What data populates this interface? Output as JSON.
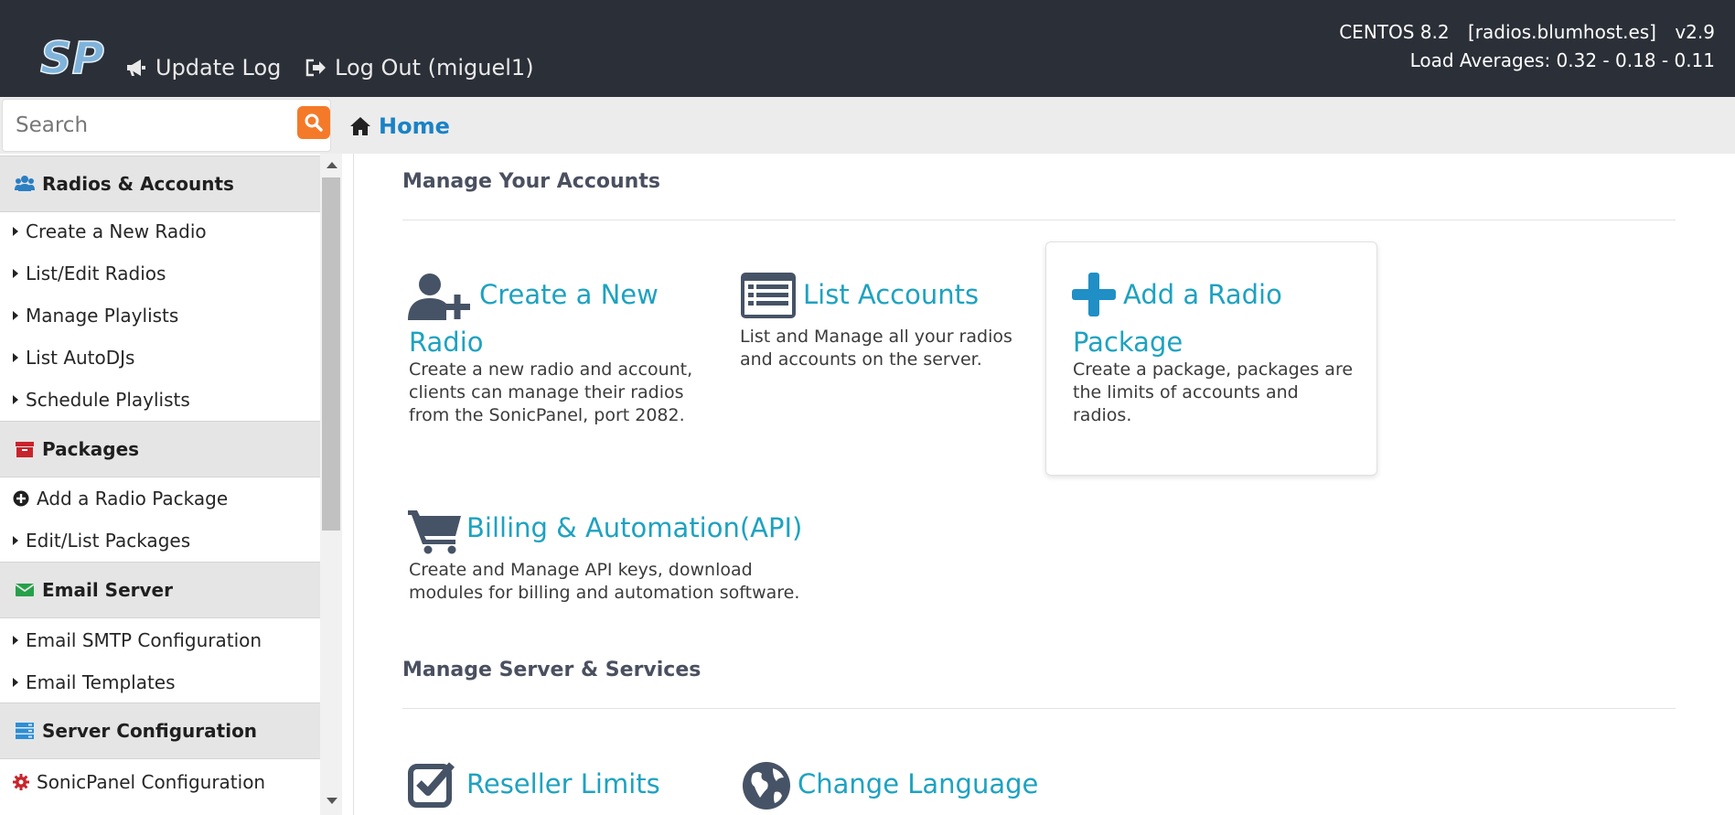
{
  "header": {
    "logo_text": "SP",
    "update_log": "Update Log",
    "logout": "Log Out (miguel1)",
    "os": "CENTOS 8.2",
    "hostname": "[radios.blumhost.es]",
    "version": "v2.9",
    "load_averages": "Load Averages: 0.32 - 0.18 - 0.11"
  },
  "search": {
    "placeholder": "Search"
  },
  "breadcrumb": {
    "home": "Home"
  },
  "sidebar": {
    "sections": [
      {
        "title": "Radios & Accounts",
        "icon": "users-icon",
        "color": "#2b7fc2"
      },
      {
        "title": "Packages",
        "icon": "archive-icon",
        "color": "#c8242b"
      },
      {
        "title": "Email Server",
        "icon": "envelope-icon",
        "color": "#27a04a"
      },
      {
        "title": "Server Configuration",
        "icon": "server-icon",
        "color": "#2b8fd6"
      }
    ],
    "radios_items": [
      "Create a New Radio",
      "List/Edit Radios",
      "Manage Playlists",
      "List AutoDJs",
      "Schedule Playlists"
    ],
    "packages_items": [
      "Add a Radio Package",
      "Edit/List Packages"
    ],
    "email_items": [
      "Email SMTP Configuration",
      "Email Templates"
    ],
    "server_items": [
      "SonicPanel Configuration"
    ]
  },
  "main": {
    "accounts_title": "Manage Your Accounts",
    "server_title": "Manage Server & Services",
    "cards": {
      "create_radio": {
        "title_line1": "Create a New",
        "title_line2": "Radio",
        "desc": [
          "Create a new radio and account,",
          "clients can manage their radios",
          "from the SonicPanel, port 2082."
        ]
      },
      "list_accounts": {
        "title": "List Accounts",
        "desc": [
          "List and Manage all your radios",
          "and accounts on the server."
        ]
      },
      "add_package": {
        "title_line1": "Add a Radio",
        "title_line2": "Package",
        "desc": [
          "Create a package, packages are",
          "the limits of accounts and",
          "radios."
        ]
      },
      "billing": {
        "title": "Billing & Automation(API)",
        "desc": [
          "Create and Manage API keys, download",
          "modules for billing and automation software."
        ]
      },
      "reseller_limits": {
        "title": "Reseller Limits"
      },
      "change_language": {
        "title": "Change Language"
      }
    }
  },
  "colors": {
    "header_bg": "#2b2f38",
    "link_teal": "#1ea2c0",
    "search_button": "#f47a2a",
    "icon_slate": "#465366"
  }
}
